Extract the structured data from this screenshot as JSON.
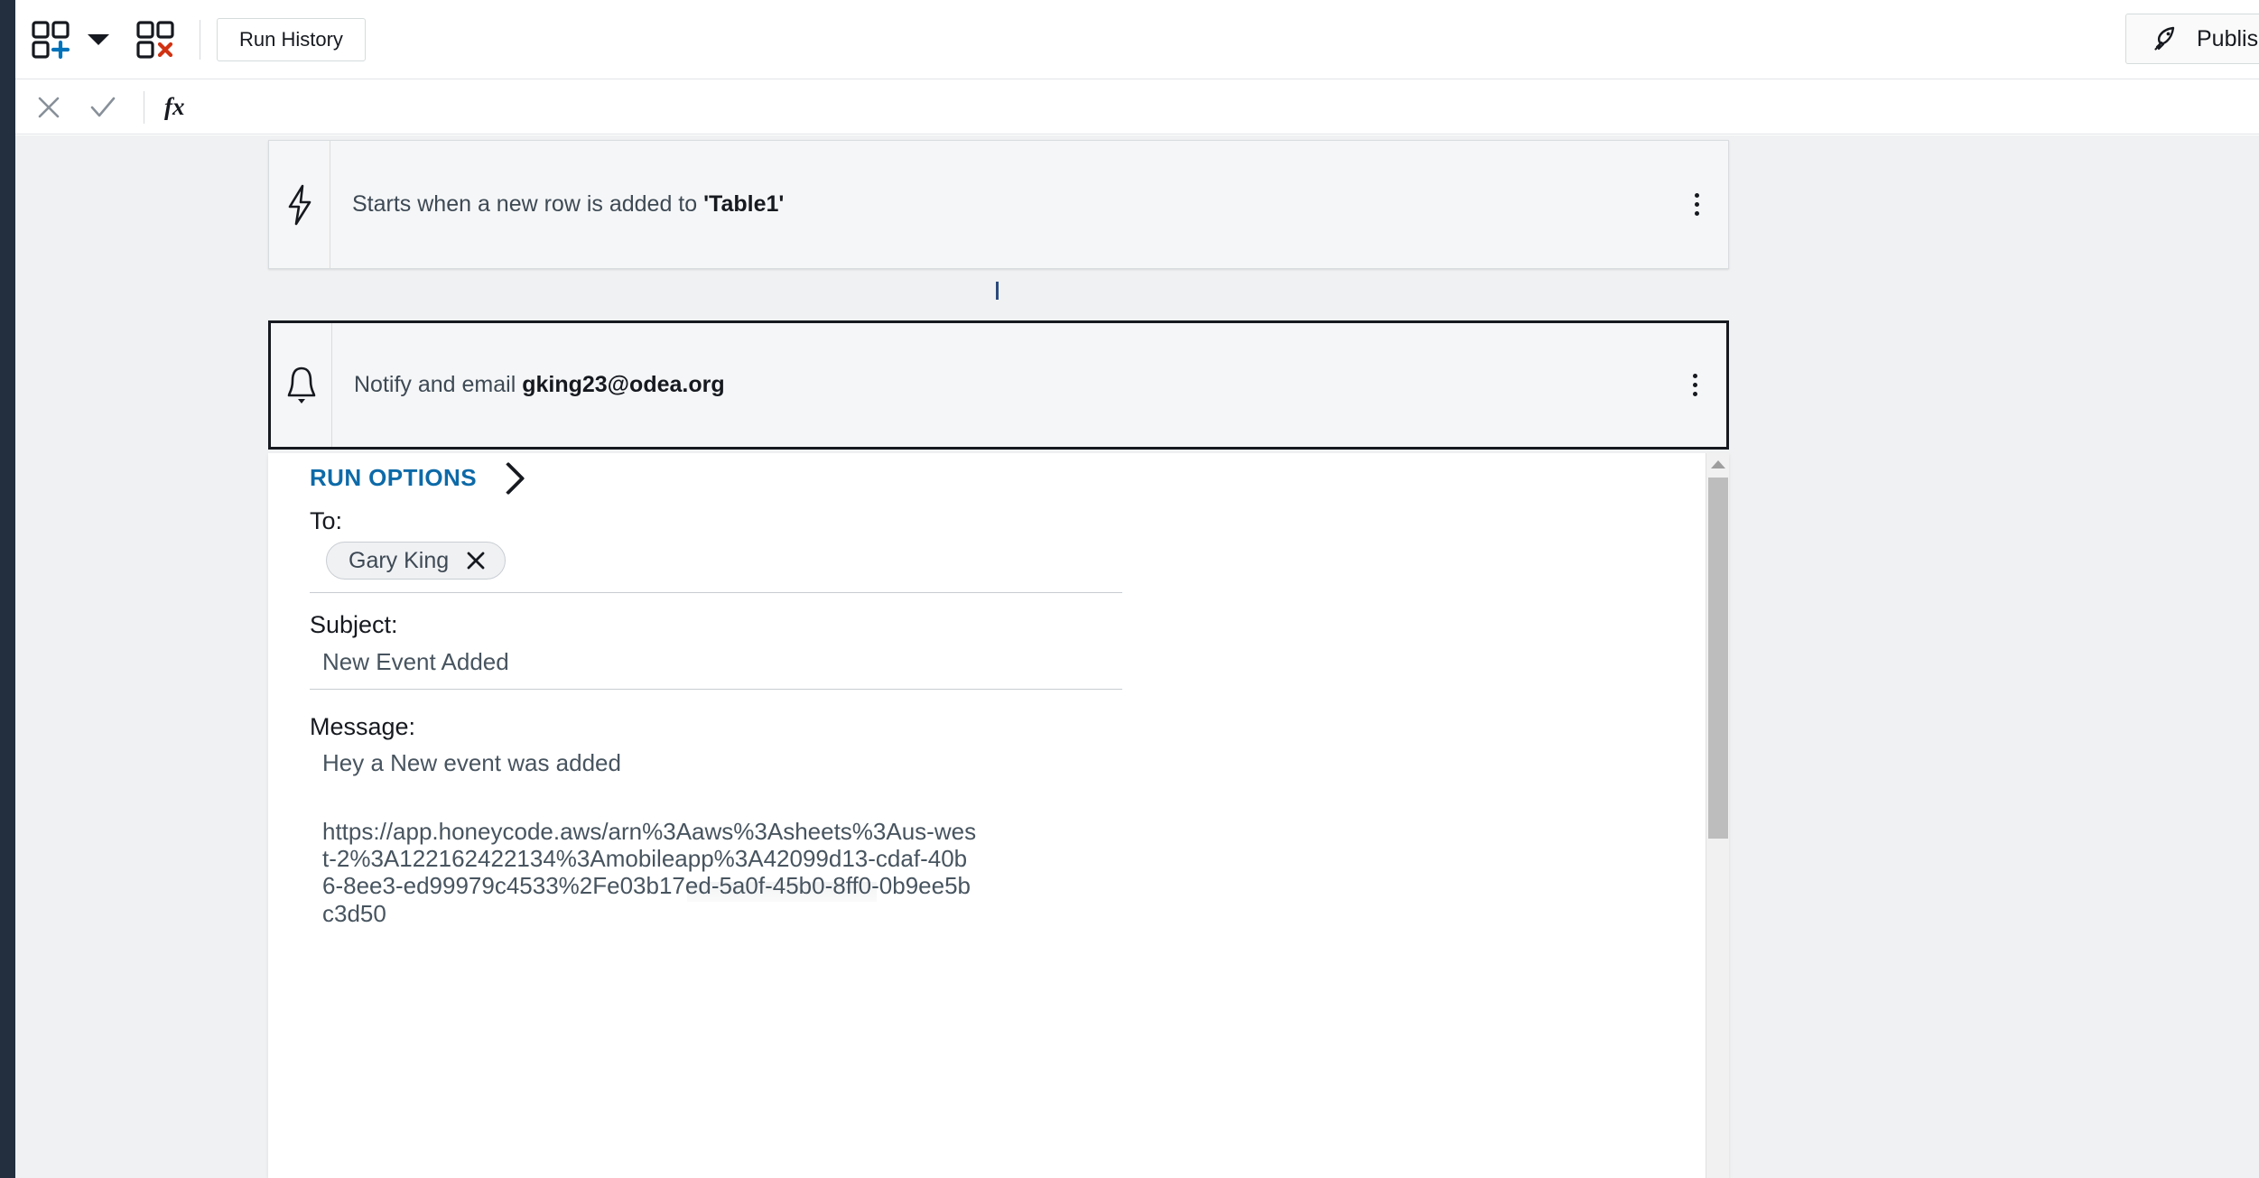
{
  "toolbar": {
    "add_block_icon": "add-grid-icon",
    "caret_icon": "chevron-down-icon",
    "delete_block_icon": "delete-grid-icon",
    "run_history_label": "Run History",
    "publish_label": "Publish",
    "publish_icon": "rocket-icon"
  },
  "formula_bar": {
    "cancel_icon": "close-icon",
    "confirm_icon": "check-icon",
    "fx_label": "fx"
  },
  "workflow": {
    "trigger": {
      "icon": "lightning-bolt-icon",
      "text_prefix": "Starts when a new row is added to ",
      "text_emphasis": "'Table1'",
      "menu_icon": "kebab-menu-icon"
    },
    "action": {
      "icon": "bell-icon",
      "text_prefix": "Notify and email ",
      "text_emphasis": "gking23@odea.org",
      "menu_icon": "kebab-menu-icon"
    }
  },
  "details": {
    "run_options_label": "RUN OPTIONS",
    "run_options_chevron": "chevron-right-icon",
    "to_label": "To:",
    "to_recipients": [
      {
        "name": "Gary King",
        "remove_icon": "close-icon"
      }
    ],
    "subject_label": "Subject:",
    "subject_value": "New Event Added",
    "message_label": "Message:",
    "message_line": "Hey a New event was added",
    "message_url": "https://app.honeycode.aws/arn%3Aaws%3Asheets%3Aus-west-2%3A122162422134%3Amobileapp%3A42099d13-cdaf-40b6-8ee3-ed99979c4533%2Fe03b17ed-5a0f-45b0-8ff0-0b9ee5bc3d50"
  },
  "scrollbar": {
    "up_arrow_icon": "scroll-up-arrow-icon",
    "thumb": "scrollbar-thumb"
  },
  "colors": {
    "accent_blue": "#0d6aa8",
    "rail_dark": "#232f3e",
    "canvas": "#eff1f2",
    "add_plus": "#0073bb",
    "delete_x": "#d13212"
  }
}
